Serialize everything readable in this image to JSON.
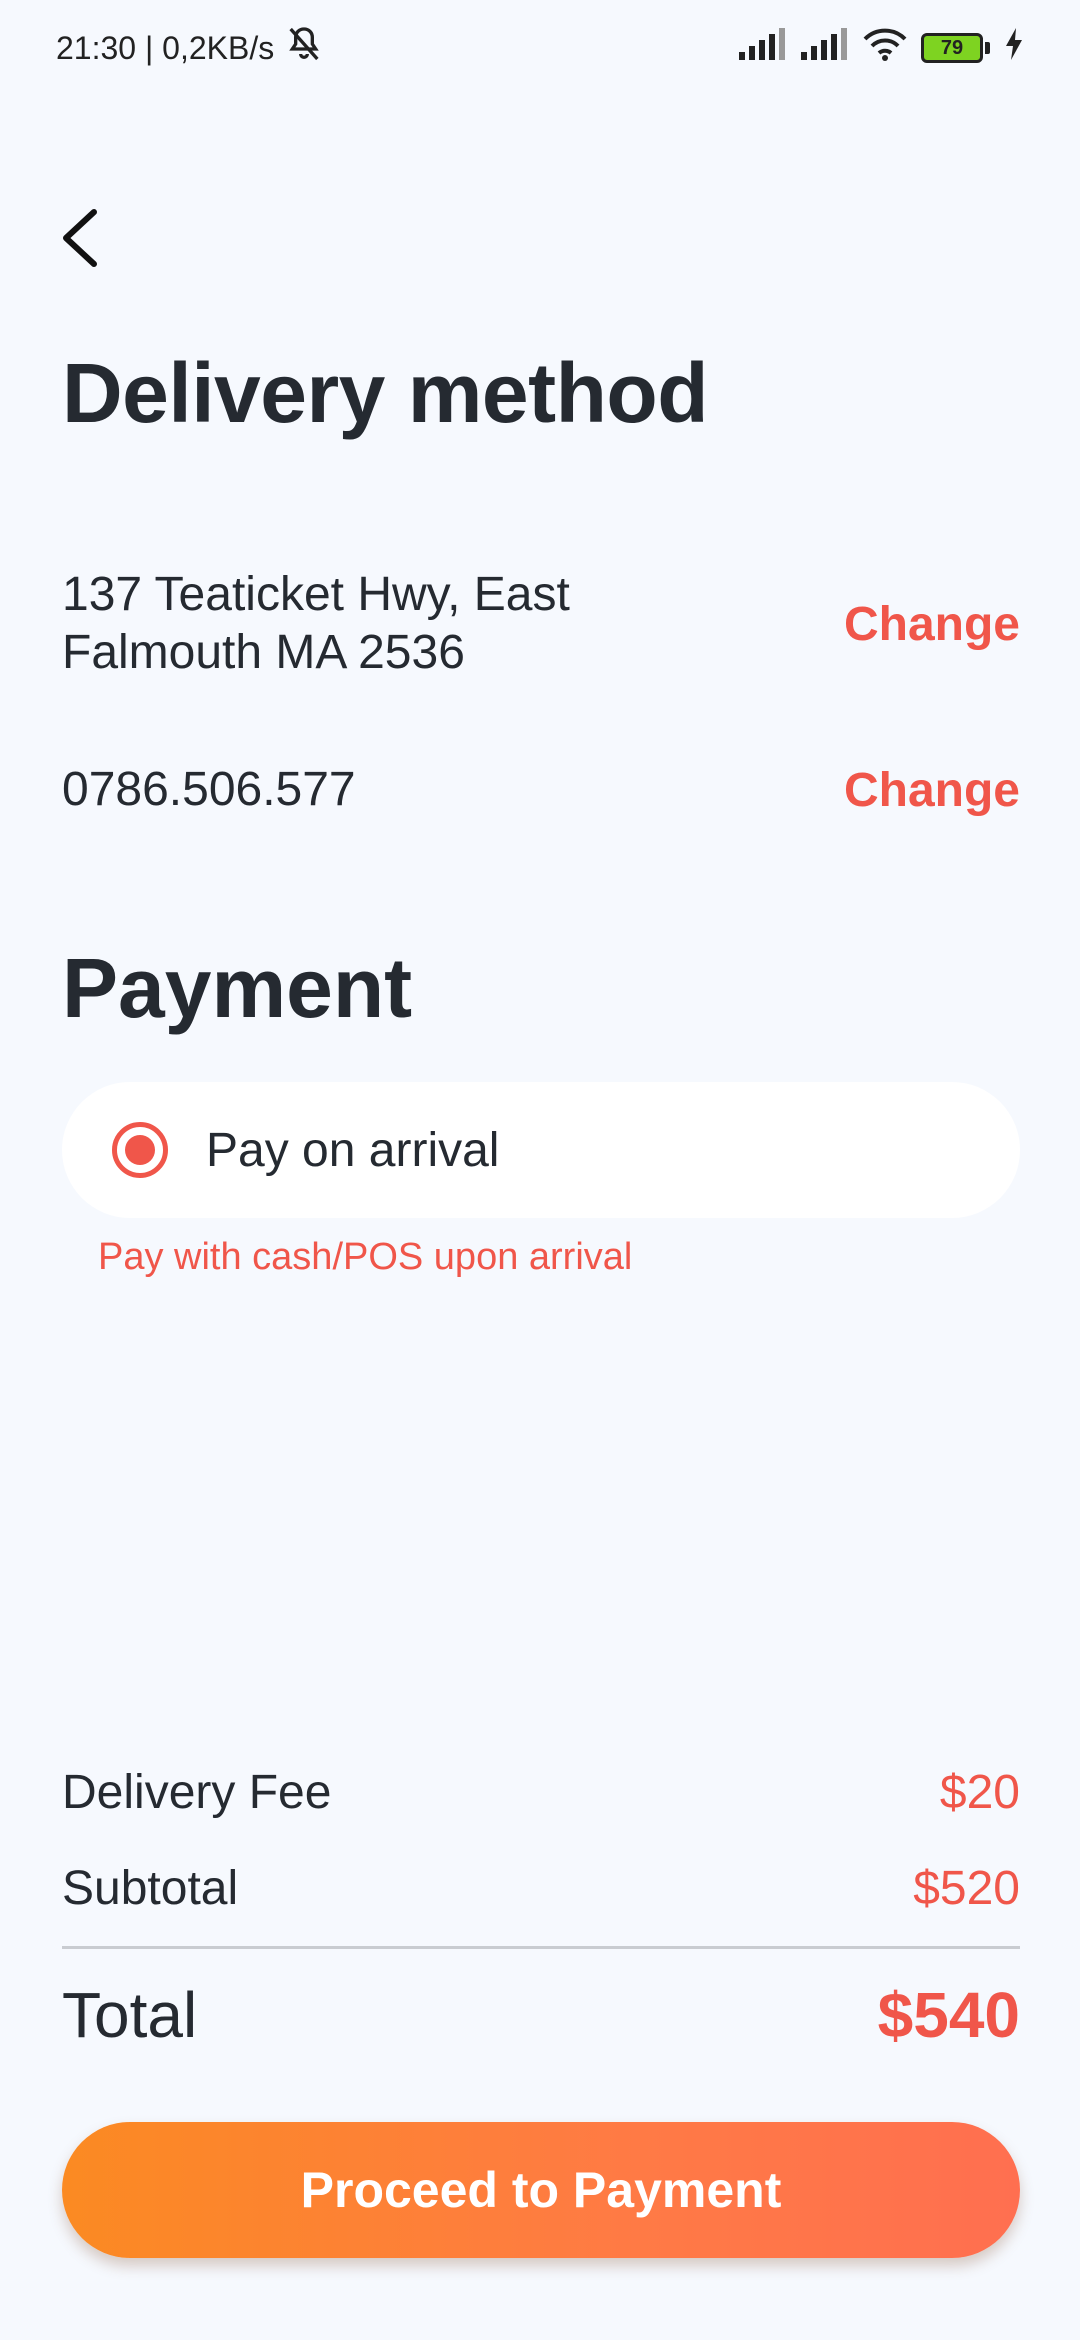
{
  "status_bar": {
    "time_speed": "21:30 | 0,2KB/s",
    "battery_level": "79"
  },
  "header": {
    "title": "Delivery method"
  },
  "delivery": {
    "address_line1": "137 Teaticket Hwy, East",
    "address_line2": "Falmouth MA 2536",
    "address_change_label": "Change",
    "phone": "0786.506.577",
    "phone_change_label": "Change"
  },
  "payment": {
    "section_title": "Payment",
    "option_label": "Pay on arrival",
    "option_selected": true,
    "note": "Pay with cash/POS upon arrival"
  },
  "summary": {
    "delivery_fee_label": "Delivery Fee",
    "delivery_fee_value": "$20",
    "subtotal_label": "Subtotal",
    "subtotal_value": "$520",
    "total_label": "Total",
    "total_value": "$540"
  },
  "actions": {
    "proceed_label": "Proceed to Payment"
  },
  "colors": {
    "background": "#F6F9FE",
    "accent": "#F0564A",
    "button_gradient_start": "#FB8A22",
    "button_gradient_end": "#FF6F50",
    "text_primary": "#252A31"
  }
}
